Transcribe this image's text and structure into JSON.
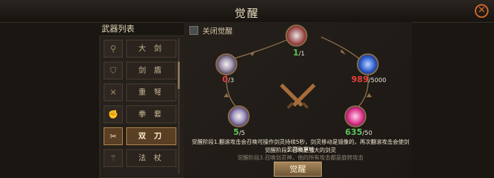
{
  "header": {
    "title": "觉醒"
  },
  "weapon_list": {
    "title": "武器列表",
    "items": [
      {
        "label": "大 剑",
        "icon": "greatsword-icon",
        "glyph": "⚲"
      },
      {
        "label": "剑 盾",
        "icon": "sword-shield-icon",
        "glyph": "⛉"
      },
      {
        "label": "重 弩",
        "icon": "crossbow-icon",
        "glyph": "✕"
      },
      {
        "label": "拳 套",
        "icon": "gauntlet-icon",
        "glyph": "✊"
      },
      {
        "label": "双 刀",
        "icon": "dual-blades-icon",
        "glyph": "✂",
        "selected": true
      },
      {
        "label": "法 杖",
        "icon": "staff-icon",
        "glyph": "⚚"
      }
    ]
  },
  "toggle_label": "关闭觉醒",
  "nodes": {
    "top": {
      "current": "1",
      "max": "/1"
    },
    "left": {
      "current": "0",
      "max": "/3"
    },
    "right": {
      "current": "989",
      "max": "/5000"
    },
    "bottom_left": {
      "current": "5",
      "max": "/5"
    },
    "bottom_right": {
      "current": "635",
      "max": "/50"
    }
  },
  "description": {
    "line1": "觉醒阶段1.翻滚攻击会召唤可操作剑灵持续5秒，剑灵移动是镜像的，再次翻滚攻击会使剑灵回到原地",
    "line2": "觉醒阶段2.召唤更强大的剑灵",
    "line3": "觉醒阶段3.召唤剑灵神，他的所有攻击都是旋转攻击"
  },
  "awaken_button": "觉醒",
  "colors": {
    "accent": "#d2682b",
    "complete": "#5cc35a",
    "incomplete": "#e2403a"
  }
}
